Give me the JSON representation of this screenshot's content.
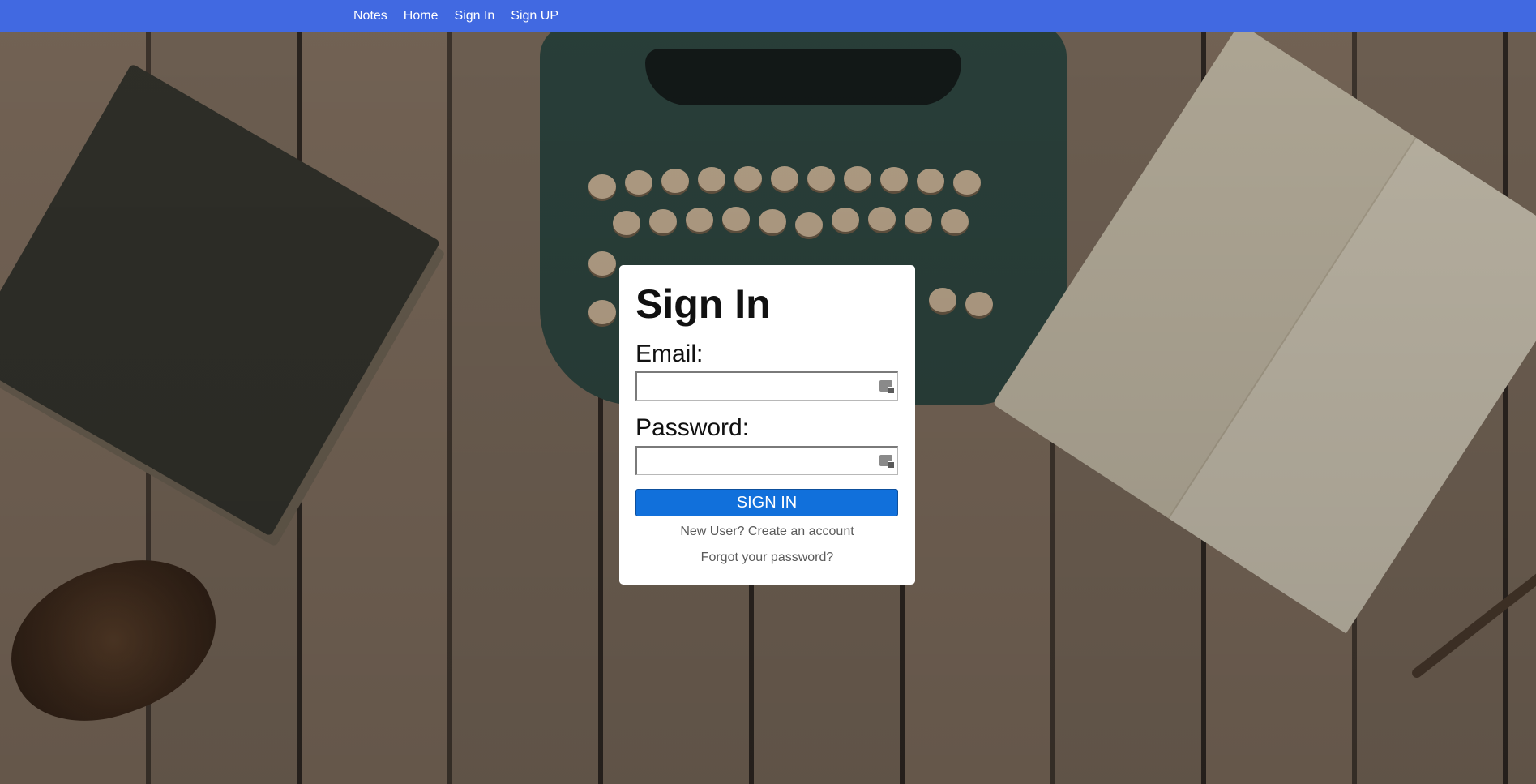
{
  "nav": {
    "brand": "Notes",
    "items": [
      {
        "label": "Home"
      },
      {
        "label": "Sign In"
      },
      {
        "label": "Sign UP"
      }
    ]
  },
  "signin": {
    "title": "Sign In",
    "email_label": "Email:",
    "email_value": "",
    "password_label": "Password:",
    "password_value": "",
    "submit_label": "SIGN IN",
    "create_account_link": "New User? Create an account",
    "forgot_password_link": "Forgot your password?"
  },
  "colors": {
    "navbar": "#4169e1",
    "button": "#1170db",
    "card": "#ffffff"
  },
  "icons": {
    "field_icon": "password-manager-icon"
  }
}
